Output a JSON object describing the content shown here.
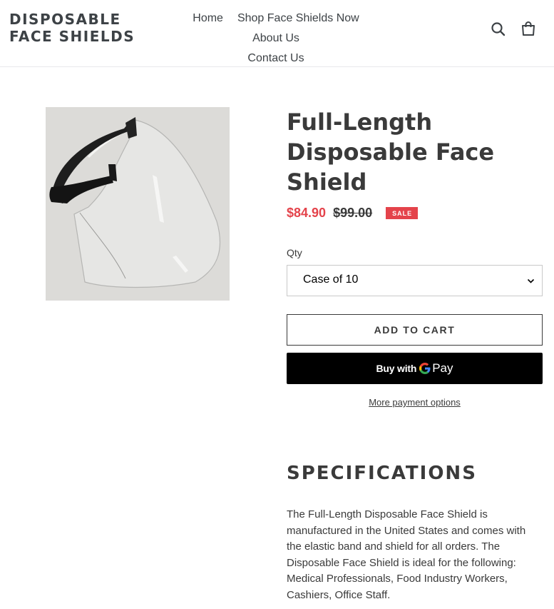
{
  "header": {
    "logo_line1": "DISPOSABLE",
    "logo_line2": "FACE SHIELDS",
    "nav": [
      {
        "label": "Home"
      },
      {
        "label": "Shop Face Shields Now"
      },
      {
        "label": "About Us"
      },
      {
        "label": "Contact Us"
      }
    ],
    "icons": [
      "search-icon",
      "cart-icon"
    ]
  },
  "product": {
    "title": "Full-Length Disposable Face Shield",
    "sale_price": "$84.90",
    "regular_price": "$99.00",
    "sale_badge": "SALE",
    "qty_label": "Qty",
    "qty_selected": "Case of 10",
    "add_to_cart_label": "ADD TO CART",
    "buy_with_label": "Buy with",
    "gpay_g": "G",
    "gpay_pay": "Pay",
    "more_payment_label": "More payment options"
  },
  "specifications": {
    "heading": "SPECIFICATIONS",
    "body": "The Full-Length Disposable Face Shield is manufactured in the United States and comes with the elastic band and shield for all orders.  The Disposable Face Shield is ideal for the following: Medical Professionals, Food Industry Workers, Cashiers, Office Staff."
  },
  "colors": {
    "sale_red": "#e4434b",
    "text_dark": "#3a3a3a",
    "gpay_button": "#000000"
  }
}
